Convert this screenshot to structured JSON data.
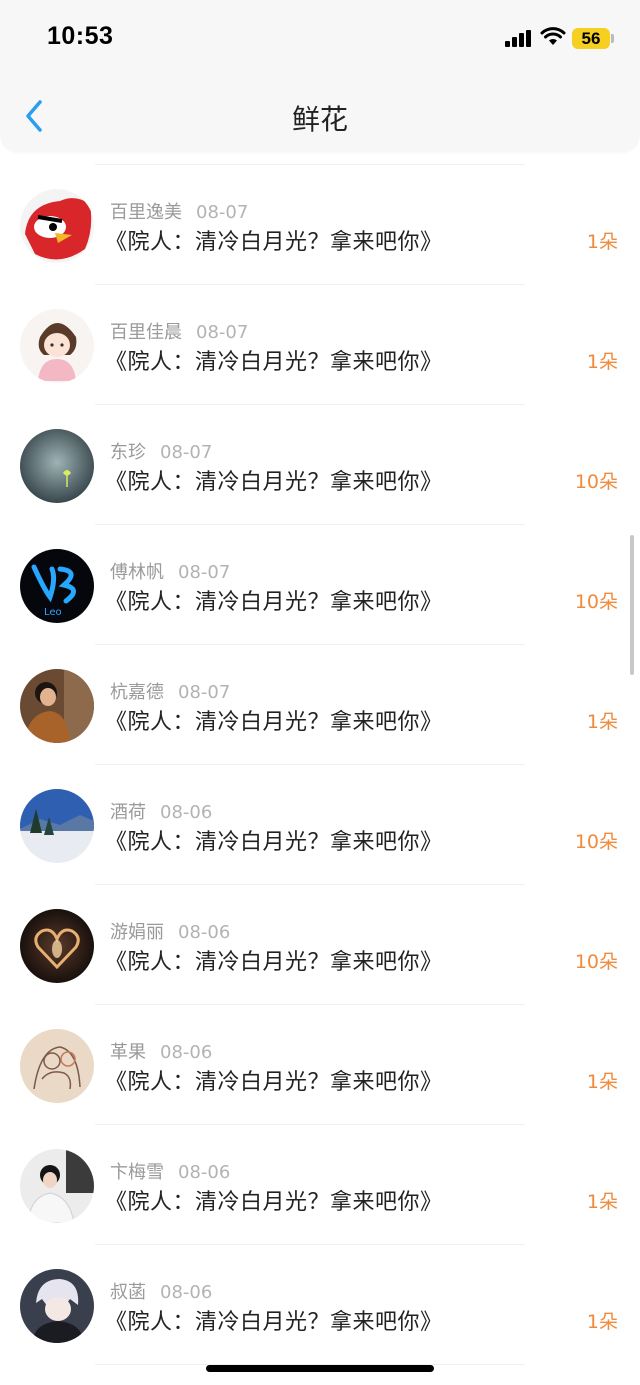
{
  "status": {
    "time": "10:53",
    "battery": "56"
  },
  "header": {
    "title": "鲜花"
  },
  "items": [
    {
      "name": "百里逸美",
      "date": "08-07",
      "book": "《院人：清冷白月光？拿来吧你》",
      "flowers": "1朵"
    },
    {
      "name": "百里佳晨",
      "date": "08-07",
      "book": "《院人：清冷白月光？拿来吧你》",
      "flowers": "1朵"
    },
    {
      "name": "东珍",
      "date": "08-07",
      "book": "《院人：清冷白月光？拿来吧你》",
      "flowers": "10朵"
    },
    {
      "name": "傅林帆",
      "date": "08-07",
      "book": "《院人：清冷白月光？拿来吧你》",
      "flowers": "10朵"
    },
    {
      "name": "杭嘉德",
      "date": "08-07",
      "book": "《院人：清冷白月光？拿来吧你》",
      "flowers": "1朵"
    },
    {
      "name": "酒荷",
      "date": "08-06",
      "book": "《院人：清冷白月光？拿来吧你》",
      "flowers": "10朵"
    },
    {
      "name": "游娟丽",
      "date": "08-06",
      "book": "《院人：清冷白月光？拿来吧你》",
      "flowers": "10朵"
    },
    {
      "name": "革果",
      "date": "08-06",
      "book": "《院人：清冷白月光？拿来吧你》",
      "flowers": "1朵"
    },
    {
      "name": "卞梅雪",
      "date": "08-06",
      "book": "《院人：清冷白月光？拿来吧你》",
      "flowers": "1朵"
    },
    {
      "name": "叔菡",
      "date": "08-06",
      "book": "《院人：清冷白月光？拿来吧你》",
      "flowers": "1朵"
    }
  ],
  "colors": {
    "accent_blue": "#2a9ff0",
    "flower_orange": "#f08a3c"
  }
}
